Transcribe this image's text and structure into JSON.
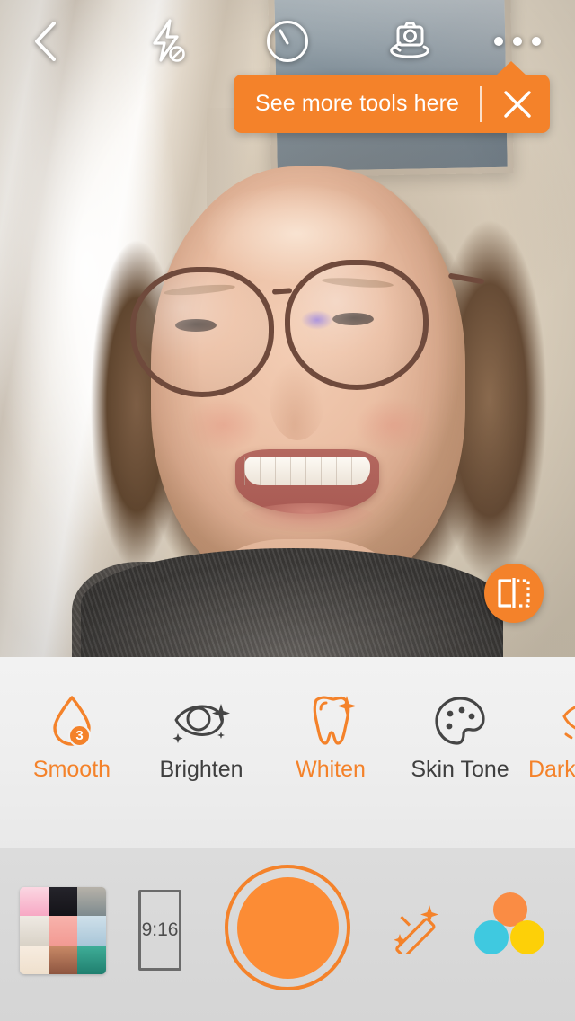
{
  "app": {
    "accent_color": "#f4822a",
    "shutter_fill": "#fc8c35"
  },
  "topbar": {
    "back_label": "Back",
    "back_icon": "chevron-left-icon",
    "flash_label": "Flash Off",
    "flash_icon": "flash-off-icon",
    "timer_label": "Timer",
    "timer_icon": "timer-icon",
    "flip_label": "Switch Camera",
    "flip_icon": "camera-flip-icon",
    "more_label": "More Tools",
    "more_icon": "more-dots-icon"
  },
  "tooltip": {
    "text": "See more tools here",
    "close_icon": "close-icon",
    "close_label": "Dismiss",
    "background_color": "#f4822a"
  },
  "viewfinder": {
    "mirror_label": "Mirror",
    "mirror_icon": "mirror-flip-icon"
  },
  "tools": {
    "items": [
      {
        "label": "Smooth",
        "icon": "water-drop-icon",
        "active": true,
        "badge": "3"
      },
      {
        "label": "Brighten",
        "icon": "eye-sparkle-icon",
        "active": false,
        "badge": ""
      },
      {
        "label": "Whiten",
        "icon": "tooth-icon",
        "active": true,
        "badge": ""
      },
      {
        "label": "Skin Tone",
        "icon": "palette-icon",
        "active": false,
        "badge": ""
      },
      {
        "label": "Dark Circles",
        "icon": "dark-circles-icon",
        "active": true,
        "badge": ""
      }
    ]
  },
  "bottombar": {
    "gallery_label": "Templates",
    "gallery_icon": "collage-thumbnail-icon",
    "gallery_tiles": [
      "#f6c2cf",
      "#1d1d22",
      "#9aa3a5",
      "#e8e3dc",
      "#f4a0a0",
      "#c8d9e4",
      "#f3e6d6",
      "#b5745c",
      "#2f9c8a"
    ],
    "ratio_label": "9:16",
    "ratio_name": "aspect-ratio-button",
    "shutter_label": "Capture",
    "shutter_icon": "shutter-button",
    "wand_label": "Auto Enhance",
    "wand_icon": "magic-wand-icon",
    "filters_label": "Filters",
    "filters_icon": "color-circles-icon",
    "filter_colors": {
      "orange": "#fa8c44",
      "cyan": "#3fc9e0",
      "yellow": "#fdd008"
    }
  }
}
